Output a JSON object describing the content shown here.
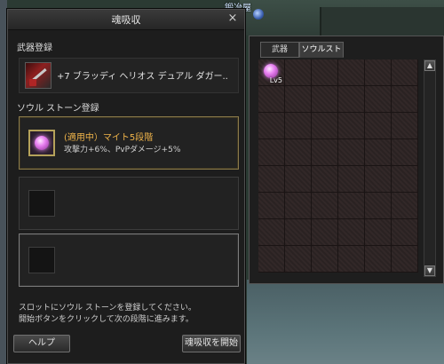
{
  "npc_label": "鍛冶屋",
  "window": {
    "title": "魂吸収",
    "close_glyph": "×",
    "weapon_section_label": "武器登録",
    "weapon_name": "+7 ブラッディ ヘリオス デュアル ダガー..",
    "soul_section_label": "ソウル ストーン登録",
    "slots": [
      {
        "title": "(適用中）マイト5段階",
        "desc": "攻撃力+6%、PvPダメージ+5%"
      },
      {
        "title": "",
        "desc": ""
      },
      {
        "title": "",
        "desc": ""
      }
    ],
    "info_line1": "スロットにソウル ストーンを登録してください。",
    "info_line2": "開始ボタンをクリックして次の段階に進みます。",
    "help_button": "ヘルプ",
    "start_button": "魂吸収を開始"
  },
  "inventory": {
    "tabs": [
      "武器",
      "ソウルストーン"
    ],
    "active_tab": 1,
    "item_level": "Lv5",
    "scroll_up": "▲",
    "scroll_down": "▼"
  },
  "colors": {
    "highlight_text": "#f0b44a",
    "gem": "#e77ef0"
  }
}
